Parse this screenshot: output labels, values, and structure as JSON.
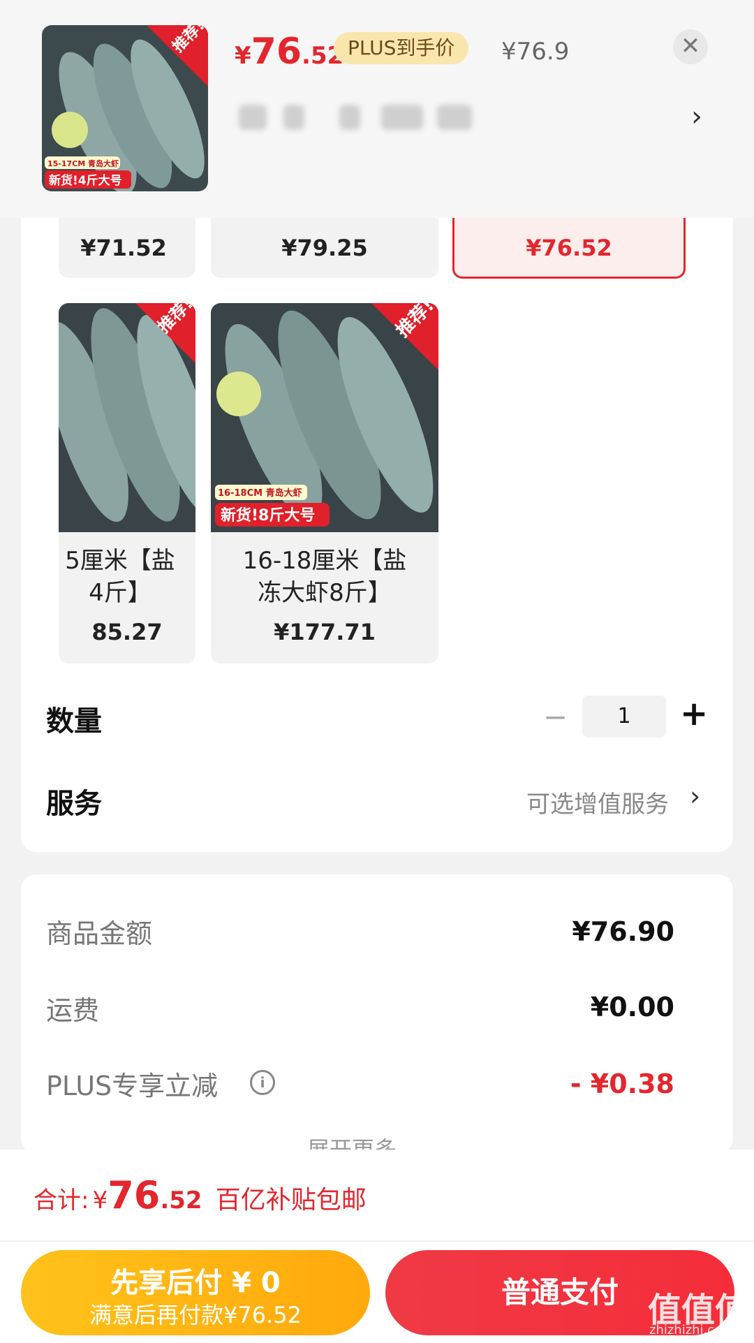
{
  "header": {
    "price_currency": "¥",
    "price_int": "76",
    "price_dec": ".52",
    "plus_badge": "PLUS到手价",
    "original_price": "¥76.9",
    "close_icon": "close-icon",
    "chevron_icon": "chevron-right-icon"
  },
  "skus": {
    "top_row": [
      {
        "price": "¥71.52",
        "selected": false
      },
      {
        "price": "¥79.25",
        "selected": false
      },
      {
        "price": "¥76.52",
        "selected": true
      }
    ],
    "cards": [
      {
        "name_l1": "5厘米【盐",
        "name_l2": "4斤】",
        "price": "85.27"
      },
      {
        "name_l1": "16-18厘米【盐",
        "name_l2": "冻大虾8斤】",
        "price": "¥177.71"
      }
    ],
    "image_texts": {
      "recommend": "推荐!",
      "size_tag_a": "15-17CM 青岛大虾",
      "banner_a": "新货!4斤大号",
      "size_tag_b": "16-18CM 青岛大虾",
      "banner_b": "新货!8斤大号"
    }
  },
  "quantity": {
    "label": "数量",
    "value": "1",
    "minus": "−",
    "plus": "+"
  },
  "service": {
    "label": "服务",
    "value": "可选增值服务"
  },
  "summary": {
    "items": [
      {
        "label": "商品金额",
        "value": "¥76.90"
      },
      {
        "label": "运费",
        "value": "¥0.00"
      },
      {
        "label": "PLUS专享立减",
        "value": "- ¥0.38"
      }
    ],
    "expand": "展开更多"
  },
  "footer": {
    "total_label": "合计:",
    "total_currency": "¥",
    "total_int": "76",
    "total_dec": ".52",
    "total_note": "百亿补贴包邮",
    "pay_later_l1": "先享后付 ¥ 0",
    "pay_later_l2": "满意后再付款¥76.52",
    "pay_normal": "普通支付"
  },
  "watermark": {
    "text": "值值值",
    "sub": "zhizhizhi.com"
  },
  "colors": {
    "accent_red": "#e4262e",
    "plus_gold": "#f8e6ad",
    "pay_later_orange": "#ffb414"
  }
}
